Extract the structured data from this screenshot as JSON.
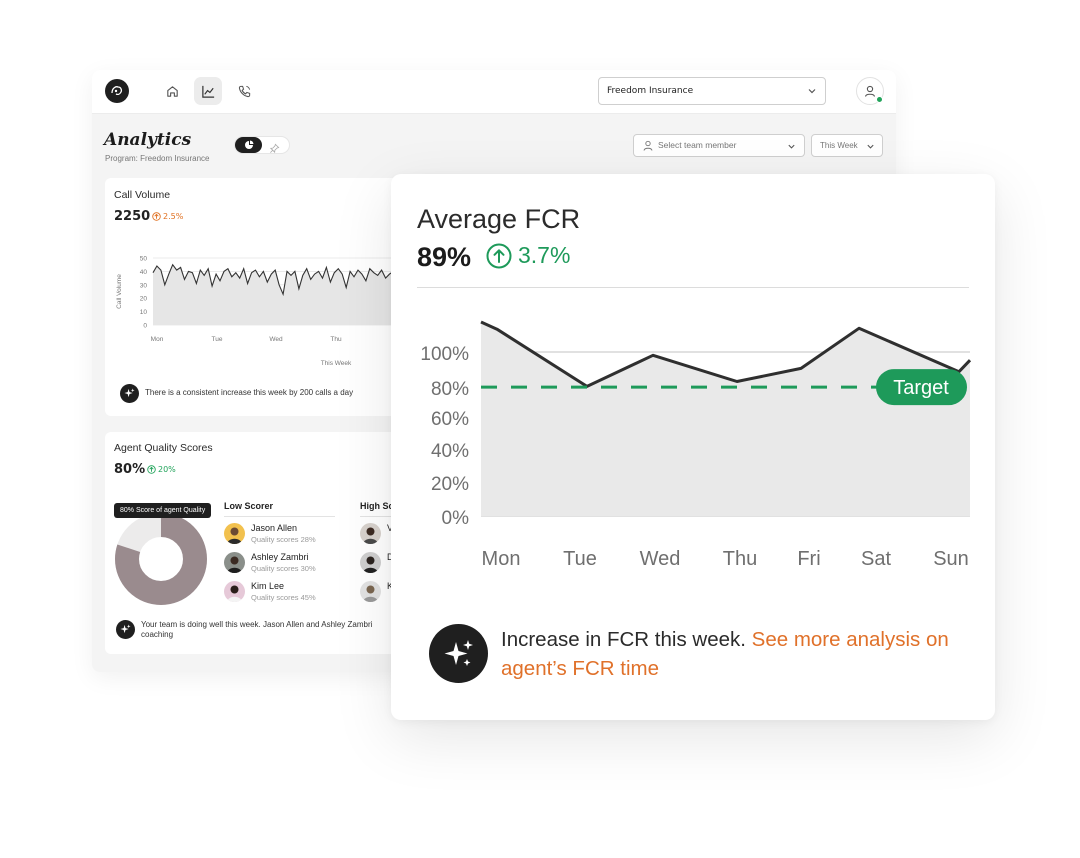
{
  "topbar": {
    "program_select_value": "Freedom Insurance",
    "nav": [
      {
        "name": "home",
        "icon": "home-icon"
      },
      {
        "name": "analytics",
        "icon": "chart-line-icon",
        "active": true
      },
      {
        "name": "calls",
        "icon": "phone-icon"
      }
    ]
  },
  "page": {
    "title": "Analytics",
    "program_label": "Program: Freedom Insurance",
    "member_placeholder": "Select team member",
    "period_value": "This Week"
  },
  "call_volume": {
    "title": "Call Volume",
    "value": "2250",
    "delta": "2.5%",
    "delta_color": "#e07020",
    "chart_data": {
      "type": "line",
      "title": "",
      "xlabel": "This Week",
      "ylabel": "Call Volume",
      "ylim": [
        0,
        50
      ],
      "yticks": [
        "50",
        "40",
        "30",
        "20",
        "10",
        "0"
      ],
      "x_tick_labels": [
        "Mon",
        "Tue",
        "Wed",
        "Thu"
      ],
      "values": [
        39,
        44,
        41,
        30,
        38,
        45,
        41,
        43,
        34,
        40,
        39,
        31,
        41,
        37,
        42,
        29,
        38,
        33,
        40,
        42,
        36,
        39,
        35,
        42,
        31,
        39,
        41,
        36,
        40,
        32,
        38,
        41,
        30,
        23,
        40,
        37,
        40,
        27,
        37,
        42,
        34,
        38,
        40,
        35,
        43,
        32,
        39,
        42,
        38,
        28,
        40,
        36,
        41,
        38,
        33,
        42,
        39,
        37,
        41,
        35,
        38,
        40,
        30,
        39,
        41,
        36,
        32,
        40,
        38,
        37
      ]
    },
    "insight": "There is a consistent increase this week by 200 calls a day"
  },
  "agent_quality": {
    "title": "Agent Quality Scores",
    "value": "80%",
    "delta": "20%",
    "delta_color": "#21a35a",
    "tooltip": "80% Score of agent Quality",
    "donut_value_percent": 80,
    "low_scorer_title": "Low Scorer",
    "high_scorer_title": "High Sc",
    "low_scorers": [
      {
        "name": "Jason Allen",
        "score": "Quality scores 28%"
      },
      {
        "name": "Ashley Zambri",
        "score": "Quality scores 30%"
      },
      {
        "name": "Kim Lee",
        "score": "Quality scores 45%"
      }
    ],
    "high_scorers_visible_initials": [
      "V",
      "D",
      "K"
    ],
    "insight": "Your team is doing well this week. Jason Allen and Ashley Zambri",
    "insight_line2": "coaching"
  },
  "fcr": {
    "title": "Average FCR",
    "value": "89%",
    "delta": "3.7%",
    "delta_color": "#1e9a5a",
    "target_label": "Target",
    "target_color": "#1e9a5a",
    "insight_text": "Increase in FCR this week.",
    "insight_link": "See more analysis on agent’s FCR time",
    "link_color": "#e0712a",
    "chart_data": {
      "type": "area",
      "title": "",
      "xlabel": "",
      "ylabel": "",
      "categories": [
        "Mon",
        "Tue",
        "Wed",
        "Thu",
        "Fri",
        "Sat",
        "Sun"
      ],
      "y_tick_labels": [
        "100%",
        "80%",
        "60%",
        "40%",
        "20%",
        "0%"
      ],
      "ylim": [
        0,
        100
      ],
      "target": 78,
      "points": [
        {
          "x": "Mon",
          "y": 109
        },
        {
          "x": "Mon",
          "y": 101
        },
        {
          "x": "Tue",
          "y": 79
        },
        {
          "x": "Wed",
          "y": 98
        },
        {
          "x": "Thu",
          "y": 82
        },
        {
          "x": "Fri",
          "y": 90
        },
        {
          "x": "Sat",
          "y": 102
        },
        {
          "x": "Sun",
          "y": 88
        },
        {
          "x": "Sun",
          "y": 95
        }
      ]
    }
  }
}
